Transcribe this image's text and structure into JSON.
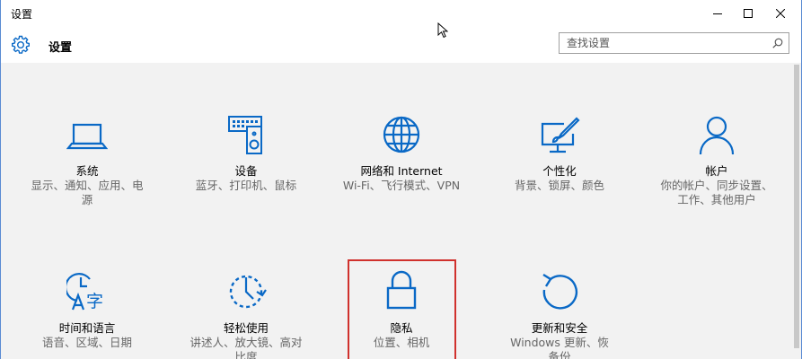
{
  "window": {
    "title": "设置"
  },
  "header": {
    "title": "设置",
    "search_placeholder": "查找设置"
  },
  "colors": {
    "accent": "#0a69c6",
    "highlight_border": "#d0312d"
  },
  "tiles": [
    {
      "label": "系统",
      "desc_lines": [
        "显示、通知、应用、电",
        "源"
      ],
      "icon": "laptop-icon"
    },
    {
      "label": "设备",
      "desc_lines": [
        "蓝牙、打印机、鼠标"
      ],
      "icon": "keyboard-speaker-icon"
    },
    {
      "label": "网络和 Internet",
      "desc_lines": [
        "Wi-Fi、飞行模式、VPN"
      ],
      "icon": "globe-icon"
    },
    {
      "label": "个性化",
      "desc_lines": [
        "背景、锁屏、颜色"
      ],
      "icon": "monitor-paintbrush-icon"
    },
    {
      "label": "帐户",
      "desc_lines": [
        "你的帐户、同步设置、",
        "工作、其他用户"
      ],
      "icon": "person-icon"
    },
    {
      "label": "时间和语言",
      "desc_lines": [
        "语音、区域、日期"
      ],
      "icon": "time-language-icon"
    },
    {
      "label": "轻松使用",
      "desc_lines": [
        "讲述人、放大镜、高对",
        "比度"
      ],
      "icon": "ease-of-access-icon"
    },
    {
      "label": "隐私",
      "desc_lines": [
        "位置、相机"
      ],
      "icon": "lock-icon"
    },
    {
      "label": "更新和安全",
      "desc_lines": [
        "Windows 更新、恢",
        "备份"
      ],
      "icon": "refresh-icon"
    }
  ]
}
